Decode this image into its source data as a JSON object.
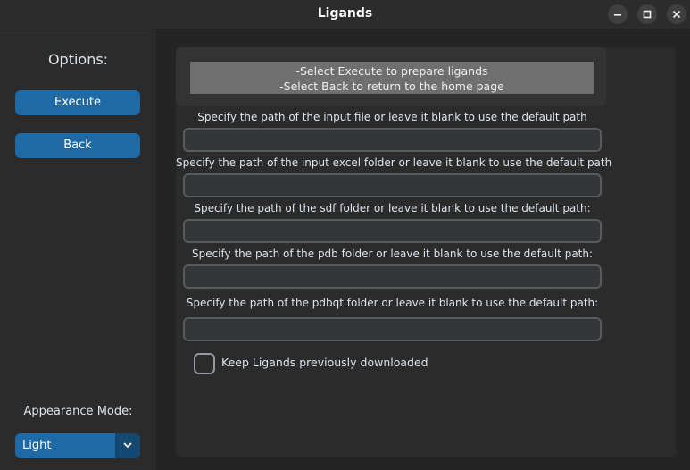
{
  "window": {
    "title": "Ligands"
  },
  "sidebar": {
    "options_label": "Options:",
    "execute_label": "Execute",
    "back_label": "Back",
    "appearance_label": "Appearance Mode:",
    "appearance_value": "Light"
  },
  "main": {
    "info_line1": "-Select Execute to prepare ligands",
    "info_line2": "-Select Back to return to the home page",
    "fields": [
      {
        "label": "Specify the path of the input file or leave it blank to use the default path",
        "value": ""
      },
      {
        "label": "Specify the path of the input excel folder or leave it blank to use the default path",
        "value": ""
      },
      {
        "label": "Specify the path of the sdf folder or leave it blank to use the default path:",
        "value": ""
      },
      {
        "label": "Specify the path of the pdb folder or leave it blank to use the default path:",
        "value": ""
      },
      {
        "label": "Specify the path of the pdbqt folder or leave it blank to use the default path:",
        "value": ""
      }
    ],
    "checkbox_label": "Keep Ligands previously downloaded",
    "checkbox_checked": false
  },
  "colors": {
    "accent": "#1f6aa5",
    "accent_dark": "#144870",
    "background": "#242424",
    "panel": "#2b2b2b"
  },
  "icons": {
    "minimize": "minimize-icon",
    "maximize": "maximize-icon",
    "close": "close-icon",
    "dropdown": "chevron-down-icon"
  }
}
